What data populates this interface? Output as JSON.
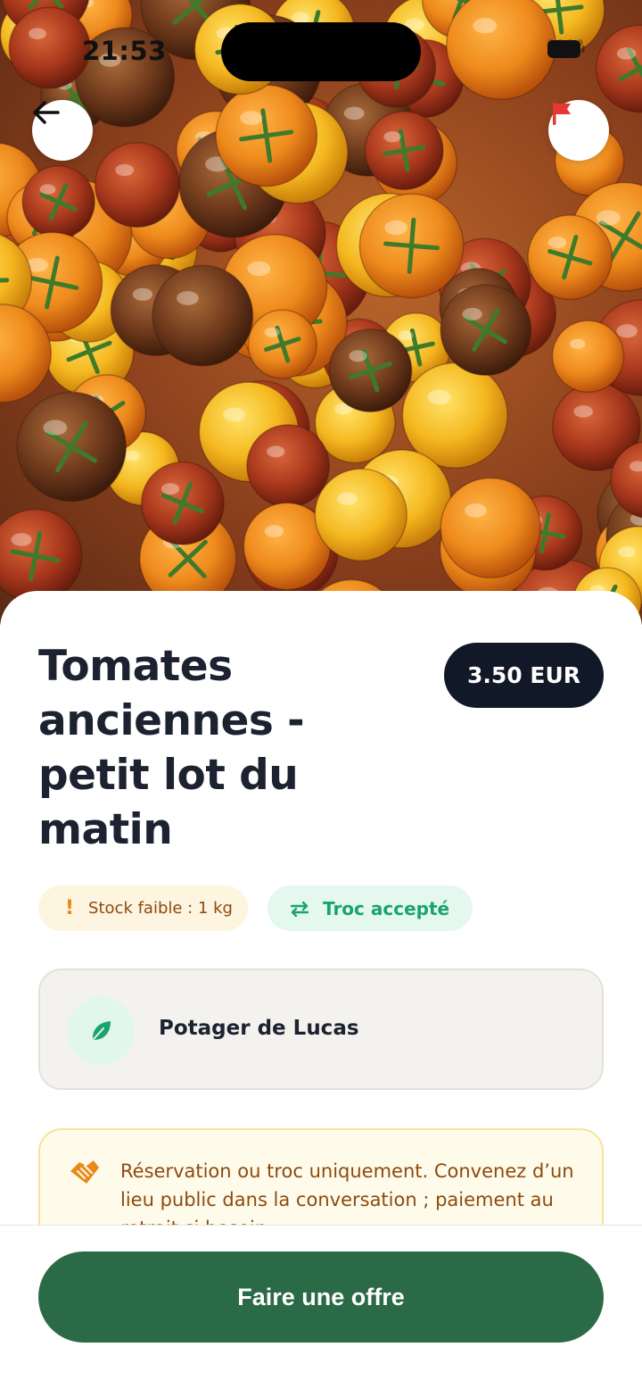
{
  "status_bar": {
    "time": "21:53"
  },
  "product": {
    "title": "Tomates anciennes - petit lot du matin",
    "price": "3.50 EUR"
  },
  "badges": {
    "stock": "Stock faible : 1 kg",
    "troc": "Troc accepté"
  },
  "seller": {
    "name": "Potager de Lucas"
  },
  "notice": {
    "text": "Réservation ou troc uniquement. Convenez d’un lieu public dans la conversation ; paiement au retrait si besoin."
  },
  "actions": {
    "offer_label": "Faire une offre"
  },
  "colors": {
    "primary": "#2b6a47",
    "price_bg": "#111827",
    "stock_text": "#8d4a0f",
    "troc_text": "#1aa46d",
    "report_flag": "#e53935"
  },
  "icons": {
    "back": "arrow-left-icon",
    "report": "flag-icon",
    "stock": "exclamation-icon",
    "troc": "swap-arrows-icon",
    "seller": "leaf-icon",
    "notice": "handshake-icon"
  }
}
